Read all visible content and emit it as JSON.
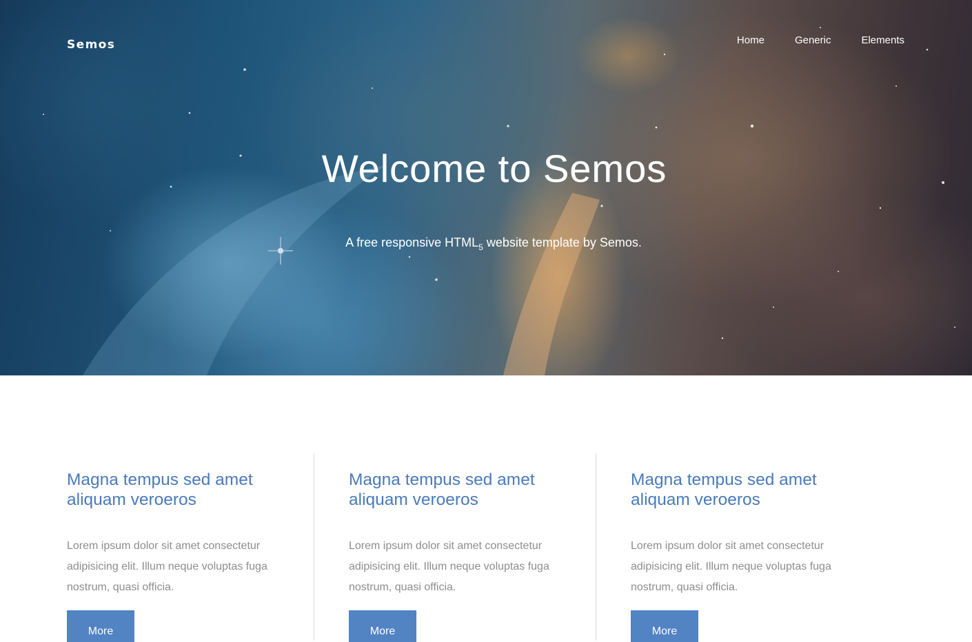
{
  "header": {
    "logo": "Semos",
    "nav": [
      "Home",
      "Generic",
      "Elements"
    ]
  },
  "hero": {
    "title": "Welcome to Semos",
    "subtitle_before": "A free responsive HTML",
    "subtitle_sub": "5",
    "subtitle_after": " website template by Semos."
  },
  "features": [
    {
      "title": "Magna tempus sed amet aliquam veroeros",
      "text": "Lorem ipsum dolor sit amet consectetur adipisicing elit. Illum neque voluptas fuga nostrum, quasi officia.",
      "button": "More"
    },
    {
      "title": "Magna tempus sed amet aliquam veroeros",
      "text": "Lorem ipsum dolor sit amet consectetur adipisicing elit. Illum neque voluptas fuga nostrum, quasi officia.",
      "button": "More"
    },
    {
      "title": "Magna tempus sed amet aliquam veroeros",
      "text": "Lorem ipsum dolor sit amet consectetur adipisicing elit. Illum neque voluptas fuga nostrum, quasi officia.",
      "button": "More"
    }
  ],
  "colors": {
    "accent": "#5283c3",
    "heading": "#4a7ab9",
    "body_text": "#8d8d8d",
    "divider": "#dddddd"
  }
}
